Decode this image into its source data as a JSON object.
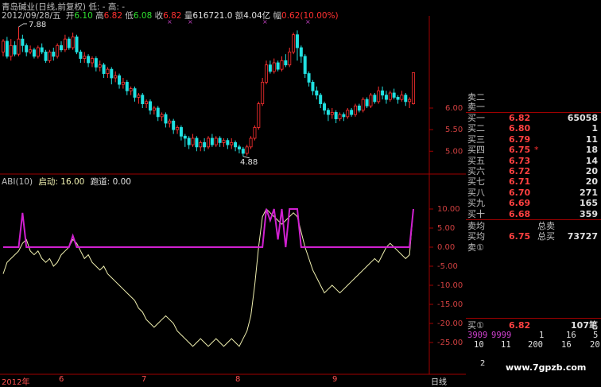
{
  "header": {
    "title": "青岛碱业(日线,前复权) 低: -  高: -",
    "date": "2012/09/28/五",
    "open_label": "开",
    "open": "6.10",
    "high_label": "高",
    "high": "6.82",
    "low_label": "低",
    "low": "6.08",
    "close_label": "收",
    "close": "6.82",
    "volume_label": "量",
    "volume": "616721.0",
    "amount_label": "额",
    "amount": "4.04亿",
    "change_label": "幅",
    "change": "0.62(10.00%)"
  },
  "price_chart": {
    "high_marker": "7.88",
    "low_marker": "4.88",
    "axis_ticks": [
      "6.00",
      "5.50",
      "5.00"
    ]
  },
  "indicator": {
    "name": "ABI(10)",
    "start_label": "启动:",
    "start_value": "16.00",
    "run_label": "跑道:",
    "run_value": "0.00",
    "axis_ticks": [
      "10.00",
      "5.00",
      "0.00",
      "-5.00",
      "-10.00",
      "-15.00",
      "-20.00",
      "-25.00"
    ]
  },
  "x_axis": {
    "labels": [
      "2012年",
      "6",
      "7",
      "8",
      "9"
    ],
    "period_button": "日线"
  },
  "order_book": {
    "sell_rows": [
      {
        "label": "卖二",
        "price": "",
        "qty": ""
      },
      {
        "label": "卖一",
        "price": "",
        "qty": ""
      }
    ],
    "buy_rows": [
      {
        "label": "买一",
        "price": "6.82",
        "qty": "65058"
      },
      {
        "label": "买二",
        "price": "6.80",
        "qty": "1"
      },
      {
        "label": "买三",
        "price": "6.79",
        "qty": "11"
      },
      {
        "label": "买四",
        "price": "6.75",
        "qty": "18"
      },
      {
        "label": "买五",
        "price": "6.73",
        "qty": "14"
      },
      {
        "label": "买六",
        "price": "6.72",
        "qty": "20"
      },
      {
        "label": "买七",
        "price": "6.71",
        "qty": "20"
      },
      {
        "label": "买八",
        "price": "6.70",
        "qty": "271"
      },
      {
        "label": "买九",
        "price": "6.69",
        "qty": "165"
      },
      {
        "label": "买十",
        "price": "6.68",
        "qty": "359"
      }
    ],
    "sell_avg_label": "卖均",
    "total_sell_label": "总卖",
    "buy_avg_label": "买均",
    "buy_avg_price": "6.75",
    "total_buy_label": "总买",
    "total_buy_qty": "73727",
    "sell_queue_label": "卖①",
    "buy_queue_label": "买①",
    "buy_queue_price": "6.82",
    "buy_queue_count": "107笔",
    "queue_first": "3909",
    "queue_second": "9999",
    "queue_values_row1": [
      "1",
      "16",
      "5"
    ],
    "queue_values_row2": [
      "10",
      "11",
      "200",
      "16",
      "20"
    ],
    "page_number": "2",
    "watermark": "www.7gpzb.com"
  },
  "colors": {
    "up": "#ff3030",
    "down": "#20e0e0",
    "line": "#f0f0b0",
    "abi": "#d020d0",
    "grid": "#a00000"
  },
  "chart_data": [
    {
      "type": "candlestick",
      "title": "",
      "ylim": [
        4.6,
        8.1
      ],
      "y_ticks": [
        5.0,
        5.5,
        6.0
      ],
      "high_label": 7.88,
      "low_label": 4.88,
      "values": [
        [
          7.3,
          7.55,
          7.2,
          7.6
        ],
        [
          7.55,
          7.2,
          7.15,
          7.65
        ],
        [
          7.2,
          7.45,
          7.1,
          7.6
        ],
        [
          7.45,
          7.25,
          7.2,
          7.55
        ],
        [
          7.25,
          7.6,
          7.2,
          7.88
        ],
        [
          7.6,
          7.45,
          7.3,
          7.7
        ],
        [
          7.45,
          7.3,
          7.2,
          7.5
        ],
        [
          7.3,
          7.35,
          7.25,
          7.45
        ],
        [
          7.35,
          7.2,
          7.15,
          7.4
        ],
        [
          7.2,
          7.4,
          7.15,
          7.45
        ],
        [
          7.4,
          7.3,
          7.25,
          7.5
        ],
        [
          7.3,
          7.1,
          7.05,
          7.35
        ],
        [
          7.1,
          7.3,
          7.05,
          7.35
        ],
        [
          7.3,
          7.2,
          7.1,
          7.4
        ],
        [
          7.2,
          7.45,
          7.15,
          7.5
        ],
        [
          7.45,
          7.35,
          7.3,
          7.55
        ],
        [
          7.35,
          7.6,
          7.3,
          7.7
        ],
        [
          7.6,
          7.4,
          7.35,
          7.65
        ],
        [
          7.4,
          7.65,
          7.35,
          7.75
        ],
        [
          7.65,
          7.3,
          7.25,
          7.7
        ],
        [
          7.3,
          7.15,
          7.05,
          7.35
        ],
        [
          7.15,
          7.2,
          7.05,
          7.3
        ],
        [
          7.2,
          7.05,
          6.95,
          7.25
        ],
        [
          7.05,
          7.15,
          6.95,
          7.2
        ],
        [
          7.15,
          6.95,
          6.85,
          7.2
        ],
        [
          6.95,
          7.0,
          6.85,
          7.1
        ],
        [
          7.0,
          6.8,
          6.7,
          7.05
        ],
        [
          6.8,
          6.9,
          6.7,
          6.95
        ],
        [
          6.9,
          6.7,
          6.55,
          6.95
        ],
        [
          6.7,
          6.75,
          6.6,
          6.85
        ],
        [
          6.75,
          6.55,
          6.45,
          6.8
        ],
        [
          6.55,
          6.6,
          6.45,
          6.7
        ],
        [
          6.6,
          6.4,
          6.3,
          6.65
        ],
        [
          6.4,
          6.45,
          6.3,
          6.5
        ],
        [
          6.45,
          6.25,
          6.15,
          6.5
        ],
        [
          6.25,
          6.3,
          6.1,
          6.35
        ],
        [
          6.3,
          6.1,
          6.0,
          6.35
        ],
        [
          6.1,
          6.15,
          6.0,
          6.2
        ],
        [
          6.15,
          5.95,
          5.85,
          6.2
        ],
        [
          5.95,
          6.0,
          5.85,
          6.05
        ],
        [
          6.0,
          5.8,
          5.7,
          6.05
        ],
        [
          5.8,
          5.85,
          5.7,
          5.9
        ],
        [
          5.85,
          5.65,
          5.55,
          5.9
        ],
        [
          5.65,
          5.7,
          5.55,
          5.75
        ],
        [
          5.7,
          5.5,
          5.4,
          5.75
        ],
        [
          5.5,
          5.55,
          5.4,
          5.6
        ],
        [
          5.55,
          5.35,
          5.25,
          5.6
        ],
        [
          5.35,
          5.3,
          5.1,
          5.4
        ],
        [
          5.3,
          5.15,
          5.05,
          5.35
        ],
        [
          5.15,
          5.3,
          5.1,
          5.4
        ],
        [
          5.3,
          5.1,
          5.0,
          5.35
        ],
        [
          5.1,
          5.2,
          5.0,
          5.25
        ],
        [
          5.2,
          5.1,
          5.0,
          5.3
        ],
        [
          5.1,
          5.3,
          5.05,
          5.35
        ],
        [
          5.3,
          5.15,
          5.1,
          5.4
        ],
        [
          5.15,
          5.3,
          5.1,
          5.35
        ],
        [
          5.3,
          5.2,
          5.1,
          5.35
        ],
        [
          5.2,
          5.25,
          5.1,
          5.3
        ],
        [
          5.25,
          5.15,
          5.05,
          5.3
        ],
        [
          5.15,
          5.2,
          5.05,
          5.3
        ],
        [
          5.2,
          5.1,
          5.0,
          5.25
        ],
        [
          5.1,
          5.05,
          4.95,
          5.15
        ],
        [
          5.05,
          4.95,
          4.88,
          5.1
        ],
        [
          4.95,
          5.1,
          4.9,
          5.15
        ],
        [
          5.1,
          5.3,
          5.05,
          5.35
        ],
        [
          5.3,
          5.55,
          5.25,
          5.6
        ],
        [
          5.55,
          6.1,
          5.5,
          6.15
        ],
        [
          6.1,
          6.6,
          6.05,
          6.7
        ],
        [
          6.6,
          7.0,
          6.55,
          7.1
        ],
        [
          7.0,
          6.85,
          6.8,
          7.1
        ],
        [
          6.85,
          7.05,
          6.8,
          7.15
        ],
        [
          7.05,
          6.9,
          6.85,
          7.1
        ],
        [
          6.9,
          7.1,
          6.85,
          7.2
        ],
        [
          7.1,
          7.0,
          6.95,
          7.25
        ],
        [
          7.0,
          7.3,
          6.95,
          7.4
        ],
        [
          7.3,
          7.7,
          7.25,
          7.75
        ],
        [
          7.7,
          7.4,
          7.1,
          7.8
        ],
        [
          7.4,
          7.2,
          7.05,
          7.45
        ],
        [
          7.2,
          6.8,
          6.7,
          7.25
        ],
        [
          6.8,
          6.6,
          6.5,
          6.85
        ],
        [
          6.6,
          6.4,
          6.3,
          6.65
        ],
        [
          6.4,
          6.3,
          6.2,
          6.5
        ],
        [
          6.3,
          6.1,
          6.0,
          6.35
        ],
        [
          6.1,
          5.95,
          5.85,
          6.15
        ],
        [
          5.95,
          5.85,
          5.7,
          6.0
        ],
        [
          5.85,
          5.9,
          5.75,
          6.0
        ],
        [
          5.9,
          5.75,
          5.65,
          5.95
        ],
        [
          5.75,
          5.85,
          5.7,
          5.9
        ],
        [
          5.85,
          5.8,
          5.7,
          5.9
        ],
        [
          5.8,
          5.95,
          5.75,
          6.0
        ],
        [
          5.95,
          5.85,
          5.8,
          6.0
        ],
        [
          5.85,
          6.05,
          5.8,
          6.1
        ],
        [
          6.05,
          5.95,
          5.9,
          6.1
        ],
        [
          5.95,
          6.2,
          5.9,
          6.25
        ],
        [
          6.2,
          6.05,
          6.0,
          6.25
        ],
        [
          6.05,
          6.3,
          6.0,
          6.35
        ],
        [
          6.3,
          6.15,
          6.1,
          6.35
        ],
        [
          6.15,
          6.4,
          6.1,
          6.5
        ],
        [
          6.4,
          6.3,
          6.2,
          6.5
        ],
        [
          6.3,
          6.2,
          6.1,
          6.4
        ],
        [
          6.2,
          6.35,
          6.15,
          6.4
        ],
        [
          6.35,
          6.25,
          6.2,
          6.45
        ],
        [
          6.25,
          6.2,
          6.1,
          6.3
        ],
        [
          6.2,
          6.3,
          6.15,
          6.4
        ],
        [
          6.3,
          6.15,
          6.05,
          6.35
        ],
        [
          6.15,
          6.2,
          6.0,
          6.25
        ],
        [
          6.1,
          6.82,
          6.08,
          6.82
        ]
      ]
    },
    {
      "type": "line",
      "title": "ABI(10)",
      "ylim": [
        -30,
        11
      ],
      "y_ticks": [
        10,
        5,
        0,
        -5,
        -10,
        -15,
        -20,
        -25
      ],
      "series": [
        {
          "name": "",
          "values": [
            -7,
            -4,
            -3,
            -2,
            -1,
            1,
            2,
            -1,
            -2,
            -1,
            -3,
            -4,
            -3,
            -5,
            -4,
            -2,
            -1,
            0,
            2,
            1,
            -1,
            -3,
            -2,
            -4,
            -5,
            -6,
            -5,
            -7,
            -8,
            -9,
            -10,
            -11,
            -12,
            -13,
            -14,
            -16,
            -17,
            -19,
            -20,
            -21,
            -20,
            -19,
            -18,
            -19,
            -20,
            -22,
            -23,
            -24,
            -25,
            -26,
            -25,
            -24,
            -25,
            -26,
            -25,
            -24,
            -25,
            -26,
            -25,
            -24,
            -25,
            -26,
            -24,
            -22,
            -18,
            -10,
            0,
            8,
            10,
            9,
            8,
            7,
            6,
            7,
            8,
            9,
            8,
            4,
            0,
            -3,
            -6,
            -8,
            -10,
            -12,
            -11,
            -10,
            -11,
            -12,
            -11,
            -10,
            -9,
            -8,
            -7,
            -6,
            -5,
            -4,
            -3,
            -4,
            -2,
            0,
            1,
            0,
            -1,
            -2,
            -3,
            -2,
            10
          ]
        },
        {
          "name": "",
          "values": [
            0,
            0,
            0,
            0,
            0,
            0,
            0,
            0,
            0,
            0,
            0,
            0,
            0,
            0,
            0,
            0,
            0,
            0,
            0,
            0,
            0,
            0,
            0,
            0,
            0,
            0,
            0,
            0,
            0,
            0,
            0,
            0,
            0,
            0,
            0,
            0,
            0,
            0,
            0,
            0,
            0,
            0,
            0,
            0,
            0,
            0,
            0,
            0,
            0,
            0,
            0,
            0,
            0,
            0,
            0,
            0,
            0,
            0,
            0,
            0,
            0,
            0,
            0,
            0,
            0,
            0,
            0,
            0,
            0,
            0,
            0,
            0,
            0,
            0,
            0,
            0,
            0,
            0,
            0,
            0,
            0,
            0,
            0,
            0,
            0,
            0,
            0,
            0,
            0,
            0,
            0,
            0,
            0,
            0,
            0,
            0,
            0,
            0,
            0,
            0,
            0,
            0,
            0,
            0,
            0,
            0,
            10
          ]
        }
      ]
    }
  ]
}
